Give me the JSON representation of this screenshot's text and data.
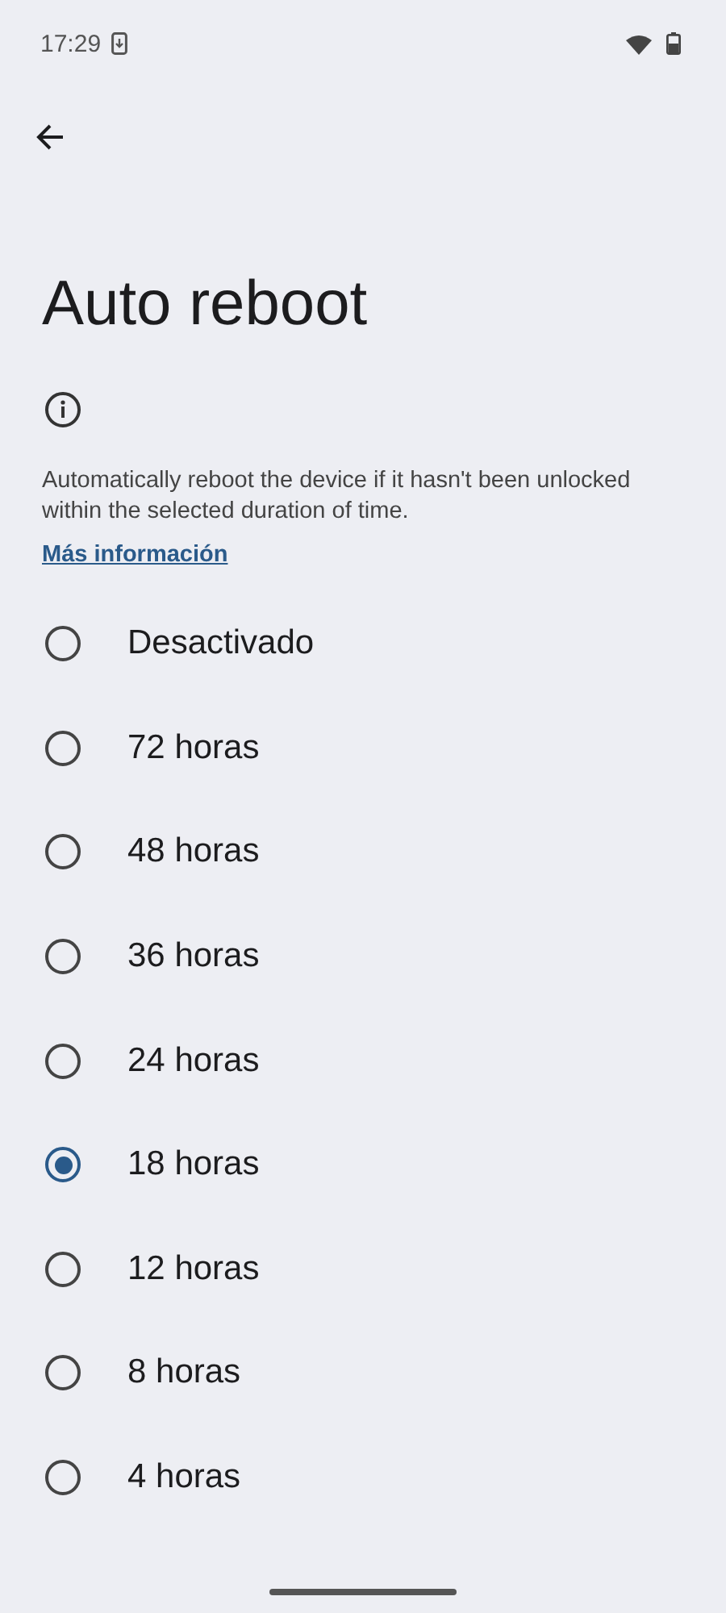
{
  "status_bar": {
    "time": "17:29"
  },
  "title": "Auto reboot",
  "description": "Automatically reboot the device if it hasn't been unlocked within the selected duration of time.",
  "link": "Más información",
  "options": [
    {
      "label": "Desactivado",
      "selected": false
    },
    {
      "label": "72 horas",
      "selected": false
    },
    {
      "label": "48 horas",
      "selected": false
    },
    {
      "label": "36 horas",
      "selected": false
    },
    {
      "label": "24 horas",
      "selected": false
    },
    {
      "label": "18 horas",
      "selected": true
    },
    {
      "label": "12 horas",
      "selected": false
    },
    {
      "label": "8 horas",
      "selected": false
    },
    {
      "label": "4 horas",
      "selected": false
    }
  ]
}
